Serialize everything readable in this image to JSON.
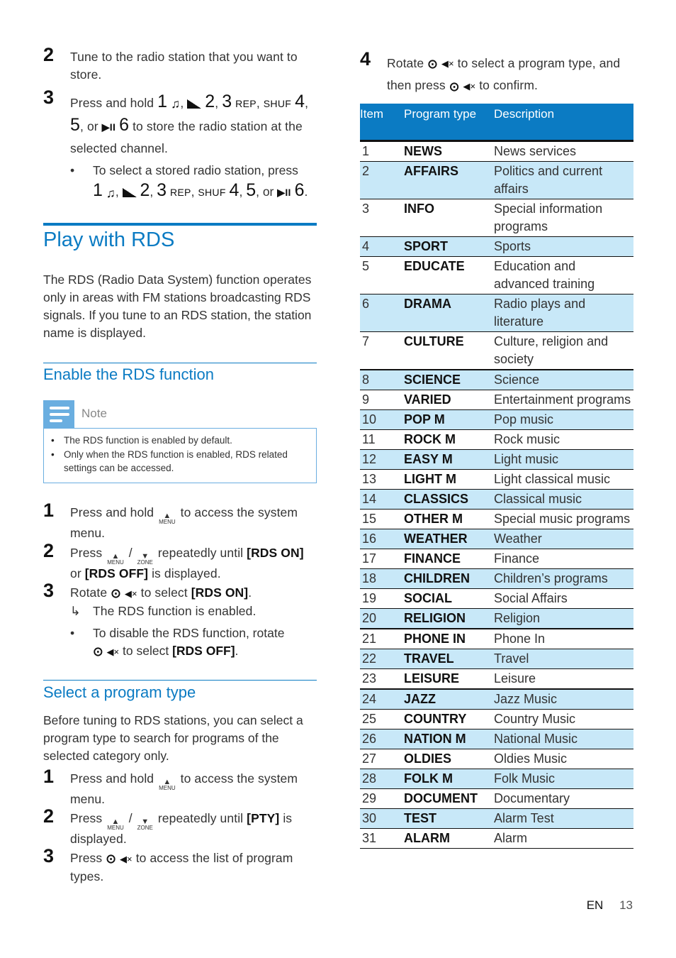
{
  "left_column": {
    "store_steps": [
      {
        "num": "2",
        "text": "Tune to the radio station that you want to store."
      },
      {
        "num": "3",
        "text_prefix": "Press and hold",
        "text_suffix": "to store the radio station at the selected channel."
      }
    ],
    "preset_keys": {
      "k1": "1",
      "k2": "2",
      "k3": "3",
      "rep": "REP",
      "shuf": "SHUF",
      "k4": "4",
      "k5": "5",
      "or": "or",
      "k6": "6",
      "music_icon": "♫",
      "signal_icon": "▮",
      "play_pause_icon": "▶II"
    },
    "store_bullet": "To select a stored radio station, press",
    "section_title": "Play with RDS",
    "intro": "The RDS (Radio Data System) function operates only in areas with FM stations broadcasting RDS signals. If you tune to an RDS station, the station name is displayed.",
    "enable_heading": "Enable the RDS function",
    "note": {
      "label": "Note",
      "items": [
        "The RDS function is enabled by default.",
        "Only when the RDS function is enabled, RDS related settings can be accessed."
      ]
    },
    "keys": {
      "menu_label": "MENU",
      "zone_label": "ZONE",
      "up_icon": "▲",
      "down_icon": "▼",
      "knob_icon": "⊙",
      "mute_icon": "🔇"
    },
    "enable_steps": [
      {
        "num": "1",
        "pre": "Press and hold",
        "post": "to access the system menu."
      },
      {
        "num": "2",
        "pre": "Press",
        "sep": "/",
        "mid": "repeatedly until",
        "b1": "[RDS ON]",
        "or": "or",
        "b2": "[RDS OFF]",
        "post": "is displayed."
      },
      {
        "num": "3",
        "pre": "Rotate",
        "mid": "to select",
        "b1": "[RDS ON]",
        "end": "."
      }
    ],
    "enable_result": "The RDS function is enabled.",
    "enable_result_icon": "↳",
    "disable_bullet": {
      "pre": "To disable the RDS function, rotate",
      "mid": "to select",
      "b": "[RDS OFF]",
      "end": "."
    },
    "select_heading": "Select a program type",
    "select_intro": "Before tuning to RDS stations, you can select a program type to search for programs of the selected category only.",
    "select_steps": [
      {
        "num": "1",
        "pre": "Press and hold",
        "post": "to access the system menu."
      },
      {
        "num": "2",
        "pre": "Press",
        "sep": "/",
        "mid": "repeatedly until",
        "b1": "[PTY]",
        "post": "is displayed."
      },
      {
        "num": "3",
        "pre": "Press",
        "post": "to access the list of program types."
      }
    ]
  },
  "right_column": {
    "step4": {
      "num": "4",
      "pre": "Rotate",
      "mid": "to select a program type, and then press",
      "post": "to confirm."
    },
    "table": {
      "headers": [
        "Item",
        "Program type",
        "Description"
      ],
      "rows": [
        {
          "item": "1",
          "type": "NEWS",
          "desc": "News services"
        },
        {
          "item": "2",
          "type": "AFFAIRS",
          "desc": "Politics and current affairs"
        },
        {
          "item": "3",
          "type": "INFO",
          "desc": "Special information programs"
        },
        {
          "item": "4",
          "type": "SPORT",
          "desc": "Sports"
        },
        {
          "item": "5",
          "type": "EDUCATE",
          "desc": "Education and advanced training"
        },
        {
          "item": "6",
          "type": "DRAMA",
          "desc": "Radio plays and literature"
        },
        {
          "item": "7",
          "type": "CULTURE",
          "desc": "Culture, religion and society"
        },
        {
          "item": "8",
          "type": "SCIENCE",
          "desc": "Science"
        },
        {
          "item": "9",
          "type": "VARIED",
          "desc": "Entertainment programs"
        },
        {
          "item": "10",
          "type": "POP M",
          "desc": "Pop music"
        },
        {
          "item": "11",
          "type": "ROCK M",
          "desc": "Rock music"
        },
        {
          "item": "12",
          "type": "EASY M",
          "desc": "Light music"
        },
        {
          "item": "13",
          "type": "LIGHT M",
          "desc": "Light classical music"
        },
        {
          "item": "14",
          "type": "CLASSICS",
          "desc": "Classical music"
        },
        {
          "item": "15",
          "type": "OTHER M",
          "desc": "Special music programs"
        },
        {
          "item": "16",
          "type": "WEATHER",
          "desc": "Weather"
        },
        {
          "item": "17",
          "type": "FINANCE",
          "desc": "Finance"
        },
        {
          "item": "18",
          "type": "CHILDREN",
          "desc": "Children’s programs"
        },
        {
          "item": "19",
          "type": "SOCIAL",
          "desc": "Social Affairs"
        },
        {
          "item": "20",
          "type": "RELIGION",
          "desc": "Religion"
        },
        {
          "item": "21",
          "type": "PHONE IN",
          "desc": "Phone In"
        },
        {
          "item": "22",
          "type": "TRAVEL",
          "desc": "Travel"
        },
        {
          "item": "23",
          "type": "LEISURE",
          "desc": "Leisure"
        },
        {
          "item": "24",
          "type": "JAZZ",
          "desc": "Jazz Music"
        },
        {
          "item": "25",
          "type": "COUNTRY",
          "desc": "Country Music"
        },
        {
          "item": "26",
          "type": "NATION M",
          "desc": "National Music"
        },
        {
          "item": "27",
          "type": "OLDIES",
          "desc": "Oldies Music"
        },
        {
          "item": "28",
          "type": "FOLK M",
          "desc": "Folk Music"
        },
        {
          "item": "29",
          "type": "DOCUMENT",
          "desc": "Documentary"
        },
        {
          "item": "30",
          "type": "TEST",
          "desc": "Alarm Test"
        },
        {
          "item": "31",
          "type": "ALARM",
          "desc": "Alarm"
        }
      ]
    }
  },
  "footer": {
    "lang": "EN",
    "page": "13"
  },
  "colors": {
    "accent": "#0b7bc3",
    "note_blue": "#6aaee0",
    "row_shade": "#c8e8f8"
  }
}
